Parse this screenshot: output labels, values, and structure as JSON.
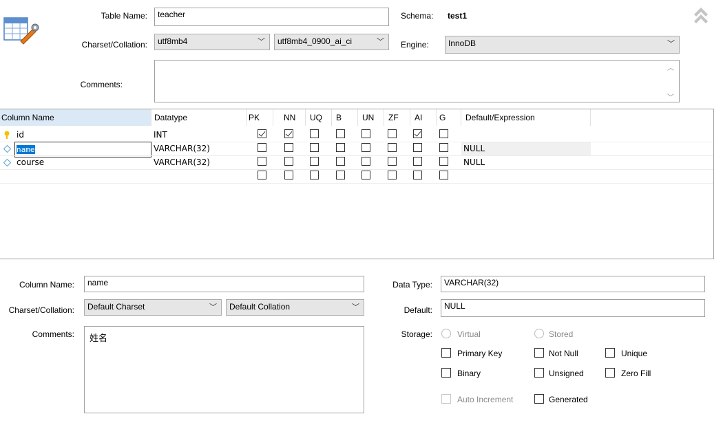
{
  "table": {
    "name_label": "Table Name:",
    "name_value": "teacher",
    "schema_label": "Schema:",
    "schema_value": "test1",
    "charset_label": "Charset/Collation:",
    "charset_value": "utf8mb4",
    "collation_value": "utf8mb4_0900_ai_ci",
    "engine_label": "Engine:",
    "engine_value": "InnoDB",
    "comments_label": "Comments:",
    "comments_value": ""
  },
  "grid": {
    "headers": [
      "Column Name",
      "Datatype",
      "PK",
      "NN",
      "UQ",
      "B",
      "UN",
      "ZF",
      "AI",
      "G",
      "Default/Expression"
    ],
    "rows": [
      {
        "name": "id",
        "type": "INT",
        "flags": [
          true,
          true,
          false,
          false,
          false,
          false,
          true,
          false
        ],
        "default": ""
      },
      {
        "name": "name",
        "type": "VARCHAR(32)",
        "flags": [
          false,
          false,
          false,
          false,
          false,
          false,
          false,
          false
        ],
        "default": "NULL"
      },
      {
        "name": "course",
        "type": "VARCHAR(32)",
        "flags": [
          false,
          false,
          false,
          false,
          false,
          false,
          false,
          false
        ],
        "default": "NULL"
      },
      {
        "name": "",
        "type": "",
        "flags": [
          false,
          false,
          false,
          false,
          false,
          false,
          false,
          false
        ],
        "default": ""
      }
    ]
  },
  "detail": {
    "column_name_label": "Column Name:",
    "column_name_value": "name",
    "data_type_label": "Data Type:",
    "data_type_value": "VARCHAR(32)",
    "charset_label": "Charset/Collation:",
    "charset_value": "Default Charset",
    "collation_value": "Default Collation",
    "default_label": "Default:",
    "default_value": "NULL",
    "comments_label": "Comments:",
    "comments_value": "姓名",
    "storage_label": "Storage:",
    "virtual_label": "Virtual",
    "stored_label": "Stored",
    "primary_key_label": "Primary Key",
    "not_null_label": "Not Null",
    "unique_label": "Unique",
    "binary_label": "Binary",
    "unsigned_label": "Unsigned",
    "zero_fill_label": "Zero Fill",
    "auto_increment_label": "Auto Increment",
    "generated_label": "Generated"
  },
  "icons": {
    "table_icon": "table-wrench-icon",
    "collapse_icon": "double-chevron-up-icon",
    "key_icon": "key-icon",
    "column_icon": "diamond-icon"
  }
}
